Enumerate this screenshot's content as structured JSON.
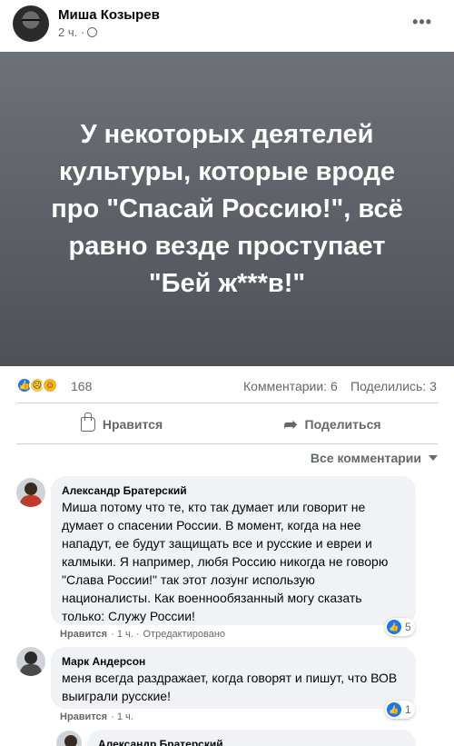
{
  "post": {
    "author": "Миша Козырев",
    "time": "2 ч. ·",
    "more_icon": "more-horizontal-icon",
    "banner_text": "У некоторых деятелей культуры, которые вроде про \"Спасай Россию!\", всё равно везде проступает \"Бей ж***в!\"",
    "reaction_count": "168",
    "comments_label": "Комментарии: 6",
    "shares_label": "Поделились: 3",
    "like_label": "Нравится",
    "share_label": "Поделиться",
    "sort_label": "Все комментарии"
  },
  "comments": [
    {
      "name": "Александр Братерский",
      "text": "Миша потому что те, кто так думает или говорит не думает о спасении России. В момент, когда на нее нападут, ее будут защищать все и русские и евреи и калмыки. Я например, любя Россию никогда не говорю \"Слава России!\" так этот лозунг использую националисты. Как военнообязанный могу сказать только: Служу России!",
      "like": "Нравится",
      "time": "· 1 ч. ·",
      "edited": "Отредактировано",
      "reacts": "5"
    },
    {
      "name": "Марк Андерсон",
      "text": "меня всегда раздражает, когда говорят и пишут, что ВОВ выиграли русские!",
      "like": "Нравится",
      "time": "· 1 ч.",
      "reacts": "1"
    },
    {
      "name": "Александр Братерский"
    }
  ],
  "colors": {
    "banner_top": "#6e7178",
    "banner_bottom": "#4e5157",
    "like_blue": "#1877f2",
    "secondary_text": "#65676b",
    "bubble_bg": "#f0f2f5"
  }
}
